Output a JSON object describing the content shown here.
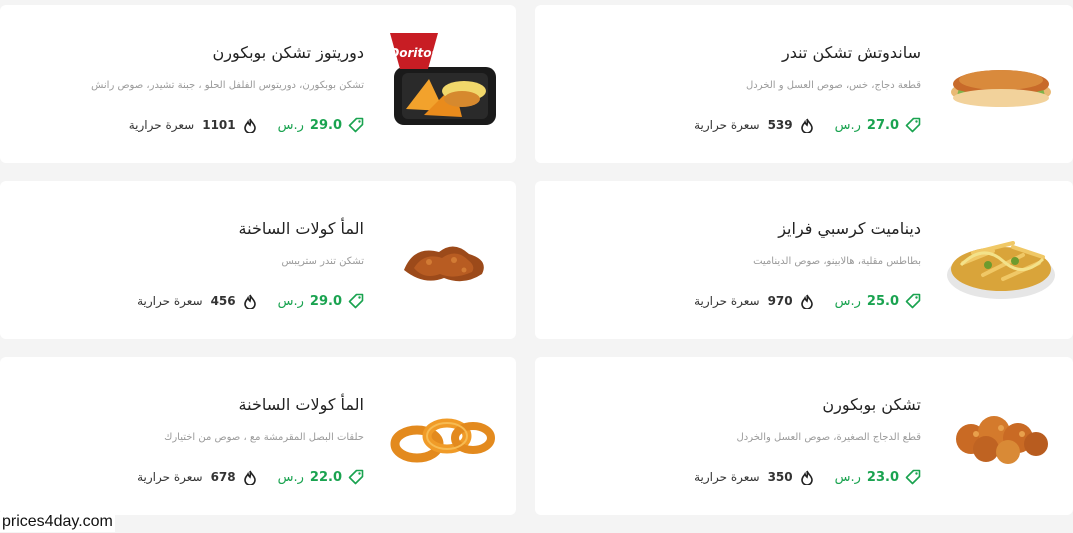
{
  "items": [
    {
      "title": "ساندوتش تشكن تندر",
      "desc": "قطعة دجاج، خس، صوص العسل و الخردل",
      "price": "27.0",
      "currency": "ر.س",
      "calories": "539",
      "cal_label": "سعرة حرارية",
      "image": "sandwich"
    },
    {
      "title": "دوريتوز تشكن بوبكورن",
      "desc": "تشكن بوبكورن، دوريتوس الفلفل الحلو ، جبنة تشيدر، صوص رانش",
      "price": "29.0",
      "currency": "ر.س",
      "calories": "1101",
      "cal_label": "سعرة حرارية",
      "image": "doritos",
      "logo_text": "Doritos"
    },
    {
      "title": "ديناميت كرسبي فرايز",
      "desc": "بطاطس مقلية، هالابينو، صوص الديناميت",
      "price": "25.0",
      "currency": "ر.س",
      "calories": "970",
      "cal_label": "سعرة حرارية",
      "image": "fries"
    },
    {
      "title": "المأ كولات الساخنة",
      "desc": "تشكن تندر ستريبس",
      "price": "29.0",
      "currency": "ر.س",
      "calories": "456",
      "cal_label": "سعرة حرارية",
      "image": "strips"
    },
    {
      "title": "تشكن بوبكورن",
      "desc": "قطع الدجاج الصغيرة، صوص العسل والخردل",
      "price": "23.0",
      "currency": "ر.س",
      "calories": "350",
      "cal_label": "سعرة حرارية",
      "image": "popcorn"
    },
    {
      "title": "المأ كولات الساخنة",
      "desc": "حلقات البصل المقرمشة مع ، صوص من اختيارك",
      "price": "22.0",
      "currency": "ر.س",
      "calories": "678",
      "cal_label": "سعرة حرارية",
      "image": "rings"
    }
  ],
  "footer": {
    "watermark": "prices4day.com"
  },
  "colors": {
    "price": "#1aa350",
    "title": "#222222",
    "desc": "#9a9a9a"
  }
}
